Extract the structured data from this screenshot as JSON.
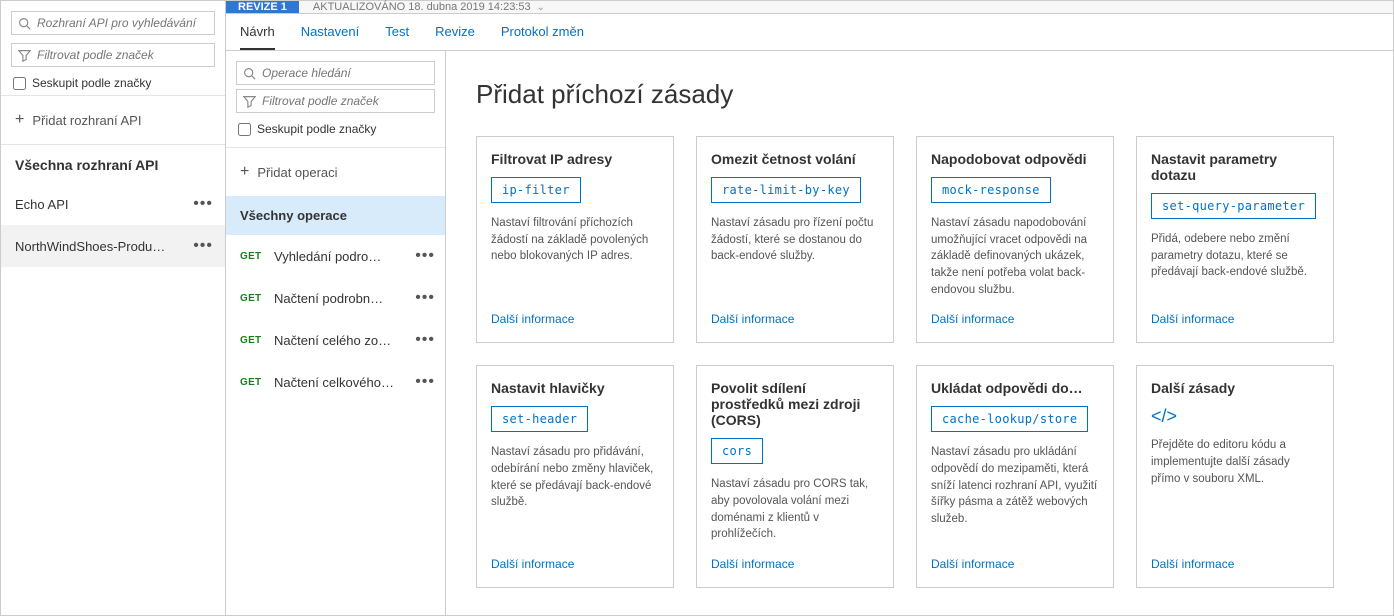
{
  "left": {
    "search_placeholder": "Rozhraní API pro vyhledávání",
    "filter_placeholder": "Filtrovat podle značek",
    "group_by_tag": "Seskupit podle značky",
    "add_api": "Přidat rozhraní API",
    "all_apis": "Všechna rozhraní API",
    "apis": [
      {
        "name": "Echo API",
        "selected": false
      },
      {
        "name": "NorthWindShoes-Produ…",
        "selected": true
      }
    ]
  },
  "header": {
    "revision_badge": "REVIZE 1",
    "updated": "AKTUALIZOVÁNO 18. dubna 2019 14:23:53"
  },
  "tabs": [
    {
      "label": "Návrh",
      "active": true
    },
    {
      "label": "Nastavení",
      "active": false
    },
    {
      "label": "Test",
      "active": false
    },
    {
      "label": "Revize",
      "active": false
    },
    {
      "label": "Protokol změn",
      "active": false
    }
  ],
  "mid": {
    "search_placeholder": "Operace hledání",
    "filter_placeholder": "Filtrovat podle značek",
    "group_by_tag": "Seskupit podle značky",
    "add_operation": "Přidat operaci",
    "all_operations": "Všechny operace",
    "operations": [
      {
        "method": "GET",
        "name": "Vyhledání podro…"
      },
      {
        "method": "GET",
        "name": "Načtení podrobn…"
      },
      {
        "method": "GET",
        "name": "Načtení celého zo…"
      },
      {
        "method": "GET",
        "name": "Načtení celkového…"
      }
    ]
  },
  "content": {
    "title": "Přidat příchozí zásady",
    "more_info": "Další informace",
    "cards": [
      {
        "title": "Filtrovat IP adresy",
        "tag": "ip-filter",
        "desc": "Nastaví filtrování příchozích žádostí na základě povolených nebo blokovaných IP adres."
      },
      {
        "title": "Omezit četnost volání",
        "tag": "rate-limit-by-key",
        "desc": "Nastaví zásadu pro řízení počtu žádostí, které se dostanou do back-endové služby."
      },
      {
        "title": "Napodobovat odpovědi",
        "tag": "mock-response",
        "desc": "Nastaví zásadu napodobování umožňující vracet odpovědi na základě definovaných ukázek, takže není potřeba volat back-endovou službu."
      },
      {
        "title": "Nastavit parametry dotazu",
        "tag": "set-query-parameter",
        "desc": "Přidá, odebere nebo změní parametry dotazu, které se předávají back-endové službě."
      },
      {
        "title": "Nastavit hlavičky",
        "tag": "set-header",
        "desc": "Nastaví zásadu pro přidávání, odebírání nebo změny hlaviček, které se předávají back-endové službě."
      },
      {
        "title": "Povolit sdílení prostředků mezi zdroji (CORS)",
        "tag": "cors",
        "desc": "Nastaví zásadu pro CORS tak, aby povolovala volání mezi doménami z klientů v prohlížečích."
      },
      {
        "title": "Ukládat odpovědi do…",
        "tag": "cache-lookup/store",
        "desc": "Nastaví zásadu pro ukládání odpovědí do mezipaměti, která sníží latenci rozhraní API, využití šířky pásma a zátěž webových služeb."
      },
      {
        "title": "Další zásady",
        "icon": true,
        "desc": "Přejděte do editoru kódu a implementujte další zásady přímo v souboru XML."
      }
    ]
  }
}
